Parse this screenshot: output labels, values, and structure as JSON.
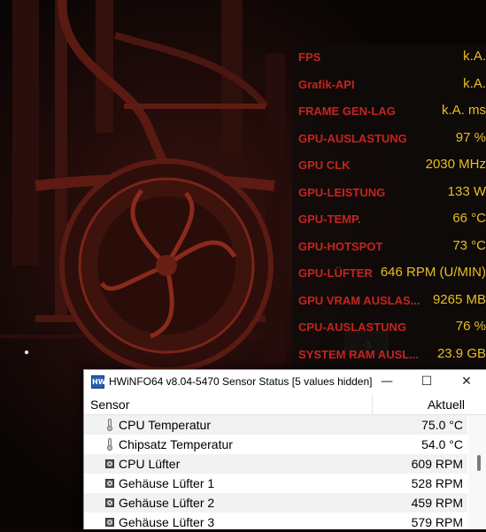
{
  "overlay": {
    "label_color": "#c4241f",
    "value_color": "#ecbe1c",
    "rows": [
      {
        "label": "FPS",
        "value": "k.A."
      },
      {
        "label": "Grafik-API",
        "value": "k.A."
      },
      {
        "label": "FRAME GEN-LAG",
        "value": "k.A. ms"
      },
      {
        "label": "GPU-AUSLASTUNG",
        "value": "97 %"
      },
      {
        "label": "GPU CLK",
        "value": "2030 MHz"
      },
      {
        "label": "GPU-LEISTUNG",
        "value": "133 W"
      },
      {
        "label": "GPU-TEMP.",
        "value": "66 °C"
      },
      {
        "label": "GPU-HOTSPOT",
        "value": "73 °C"
      },
      {
        "label": "GPU-LÜFTER",
        "value": "646 RPM (U/MIN)"
      },
      {
        "label": "GPU VRAM AUSLAS...",
        "value": "9265 MB"
      },
      {
        "label": "CPU-AUSLASTUNG",
        "value": "76 %"
      },
      {
        "label": "SYSTEM RAM AUSL...",
        "value": "23.9 GB"
      }
    ]
  },
  "hwinfo": {
    "app_icon_text": "HW",
    "title": "HWiNFO64 v8.04-5470 Sensor Status [5 values hidden]",
    "controls": {
      "minimize": "—",
      "maximize": "☐",
      "close": "✕"
    },
    "columns": {
      "sensor": "Sensor",
      "current": "Aktuell"
    },
    "rows": [
      {
        "icon": "thermometer-icon",
        "name": "CPU Temperatur",
        "value": "75.0 °C"
      },
      {
        "icon": "thermometer-icon",
        "name": "Chipsatz Temperatur",
        "value": "54.0 °C"
      },
      {
        "icon": "fan-icon",
        "name": "CPU Lüfter",
        "value": "609 RPM"
      },
      {
        "icon": "fan-icon",
        "name": "Gehäuse Lüfter 1",
        "value": "528 RPM"
      },
      {
        "icon": "fan-icon",
        "name": "Gehäuse Lüfter 2",
        "value": "459 RPM"
      },
      {
        "icon": "fan-icon",
        "name": "Gehäuse Lüfter 3",
        "value": "579 RPM"
      }
    ]
  }
}
